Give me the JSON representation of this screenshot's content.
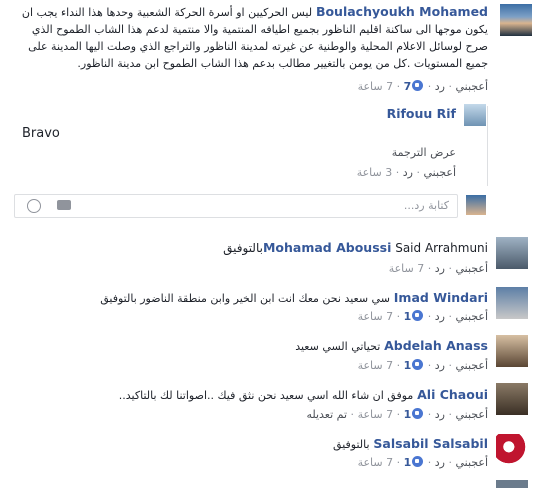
{
  "actions": {
    "like": "أعجبني",
    "reply": "رد",
    "remove_preview": "تم تعديله"
  },
  "comments": [
    {
      "author": "Boulachyoukh Mohamed",
      "text": "ليس الحركيين او أسرة الحركة الشعبية وحدها هذا النداء يجب ان يكون موجها الى ساكنة اقليم الناظور بجميع اطيافه المنتمية والا منتمية لدعم هذا الشاب الطموح الذي صرح لوسائل الاعلام المحلية والوطنية عن غيرته لمدينة الناظور والتراجع الذي وصلت اليها المدينة على جميع المستويات .كل من يومن بالتغيير مطالب بدعم هذا الشاب الطموح ابن مدينة الناظور.",
      "likes": "7",
      "time": "7 ساعة"
    },
    {
      "author": "Rifouu Rif",
      "text": "Bravo",
      "translate": "عرض الترجمة",
      "time": "3 ساعة"
    },
    {
      "author": "Mohamad Aboussi",
      "text": "Said Arrahmuniبالتوفيق",
      "time": "7 ساعة"
    },
    {
      "author": "Imad Windari",
      "text": "سي سعيد نحن معك انت ابن الخير وابن منطقة الناضور بالتوفيق",
      "likes": "1",
      "time": "7 ساعة"
    },
    {
      "author": "Abdelah Anass",
      "text": "تحياتي السي سعيد",
      "likes": "1",
      "time": "7 ساعة"
    },
    {
      "author": "Ali Chaoui",
      "text": "موفق ان شاء الله اسي سعيد نحن نثق فيك ..اصواتنا لك بالتاكيد..",
      "likes": "1",
      "time": "7 ساعة",
      "edited": "تم تعديله"
    },
    {
      "author": "Salsabil Salsabil",
      "text": "بالتوفيق",
      "likes": "1",
      "time": "7 ساعة"
    }
  ],
  "reply_placeholder": "كتابة رد...",
  "colors": {
    "link": "#365899",
    "meta": "#90949c",
    "like": "#4a76d1"
  }
}
